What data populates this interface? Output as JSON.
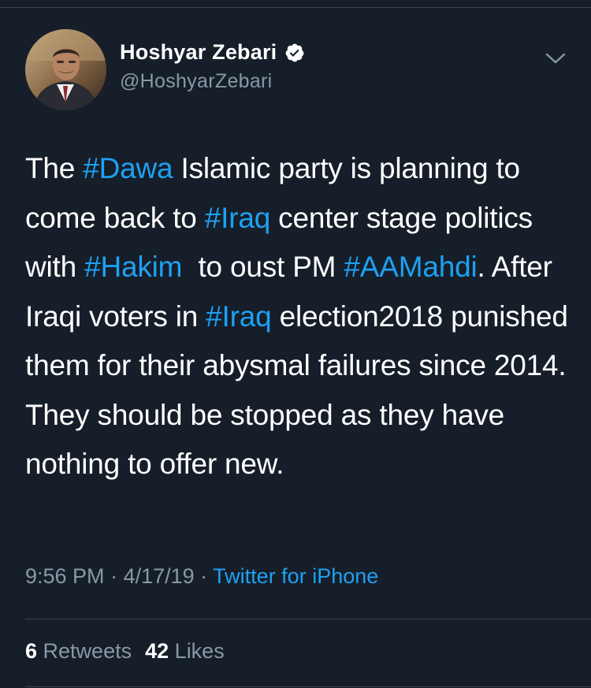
{
  "author": {
    "display_name": "Hoshyar Zebari",
    "handle": "@HoshyarZebari"
  },
  "tweet": {
    "segments": [
      {
        "text": "The ",
        "hashtag": false
      },
      {
        "text": "#Dawa",
        "hashtag": true
      },
      {
        "text": " Islamic party is planning to come back to ",
        "hashtag": false
      },
      {
        "text": "#Iraq",
        "hashtag": true
      },
      {
        "text": " center stage politics with ",
        "hashtag": false
      },
      {
        "text": "#Hakim",
        "hashtag": true
      },
      {
        "text": "  to oust PM ",
        "hashtag": false
      },
      {
        "text": "#AAMahdi",
        "hashtag": true
      },
      {
        "text": ". After Iraqi voters in ",
        "hashtag": false
      },
      {
        "text": "#Iraq",
        "hashtag": true
      },
      {
        "text": " election2018 punished them for their abysmal failures since 2014. They should be stopped as they have nothing to offer new.",
        "hashtag": false
      }
    ]
  },
  "meta": {
    "time": "9:56 PM",
    "separator": " · ",
    "date": "4/17/19",
    "source": "Twitter for iPhone"
  },
  "stats": {
    "retweets_count": "6",
    "retweets_label": "Retweets",
    "likes_count": "42",
    "likes_label": "Likes"
  },
  "colors": {
    "background": "#161e29",
    "accent": "#1da1f2",
    "secondary_text": "#8899a6",
    "divider": "#38444d"
  },
  "icons": {
    "verified": "verified-badge-icon",
    "menu": "chevron-down-icon"
  }
}
